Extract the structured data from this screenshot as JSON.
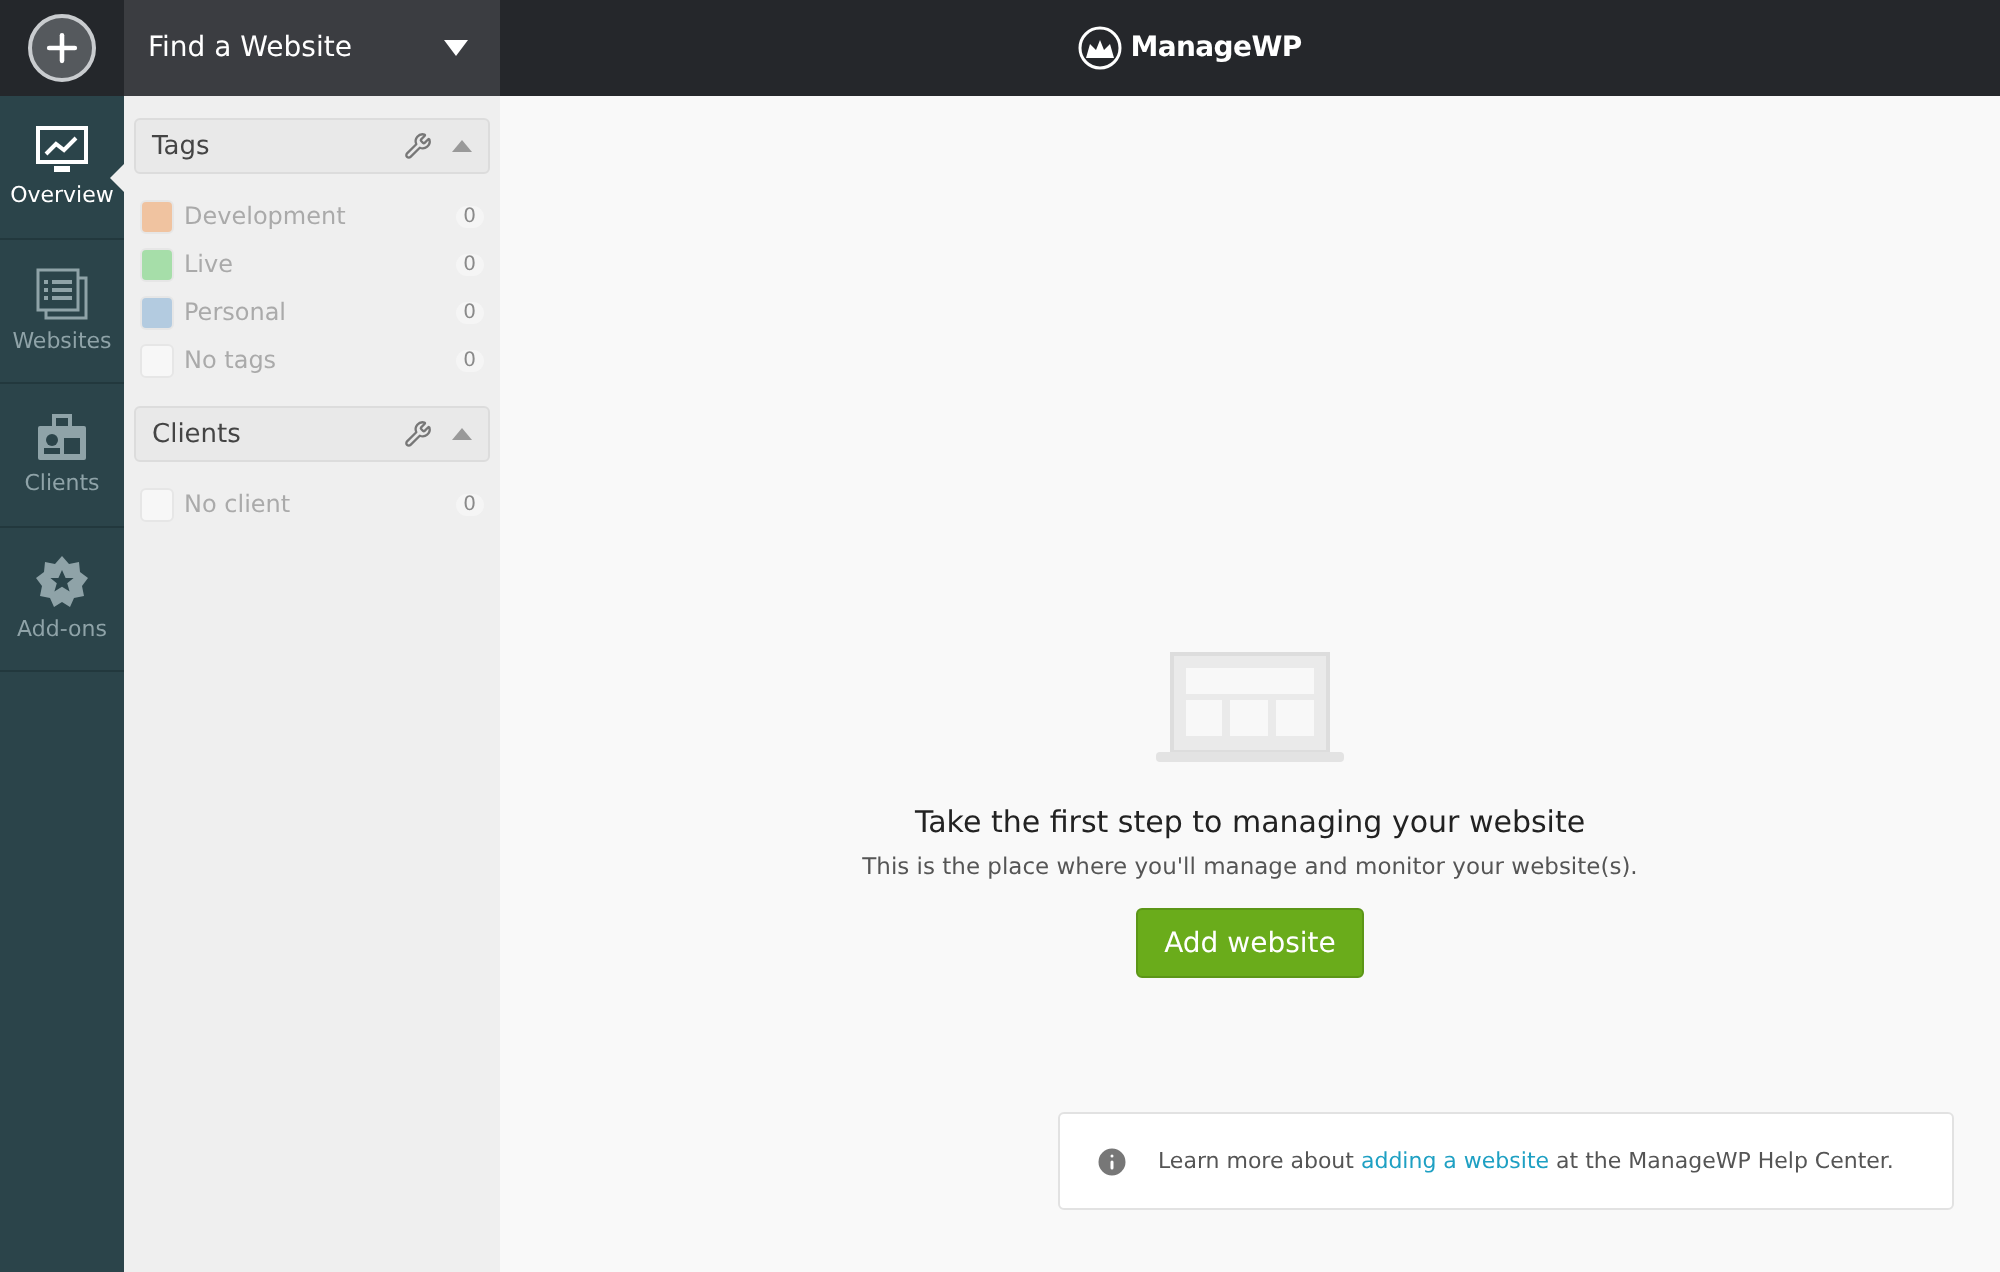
{
  "top_bar": {
    "search": {
      "placeholder": "Find a Website"
    },
    "logo_text": "ManageWP"
  },
  "nav": [
    {
      "label": "Overview",
      "selected": true
    },
    {
      "label": "Websites",
      "selected": false
    },
    {
      "label": "Clients",
      "selected": false
    },
    {
      "label": "Add-ons",
      "selected": false
    }
  ],
  "filters": [
    {
      "title": "Tags",
      "expanded": true,
      "items": [
        {
          "label": "Development",
          "count": "0",
          "color": "#f0c3a0"
        },
        {
          "label": "Live",
          "count": "0",
          "color": "#a6dea9"
        },
        {
          "label": "Personal",
          "count": "0",
          "color": "#b3cbe0"
        },
        {
          "label": "No tags",
          "count": "0"
        }
      ]
    },
    {
      "title": "Clients",
      "expanded": true,
      "items": [
        {
          "label": "No client",
          "count": "0"
        }
      ]
    }
  ],
  "empty_state": {
    "heading": "Take the first step to managing your website",
    "text": "This is the place where you'll manage and monitor your website(s).",
    "button": "Add website"
  },
  "help": {
    "before": "Learn more about",
    "link": "adding a website",
    "after": "at the ManageWP Help Center."
  }
}
